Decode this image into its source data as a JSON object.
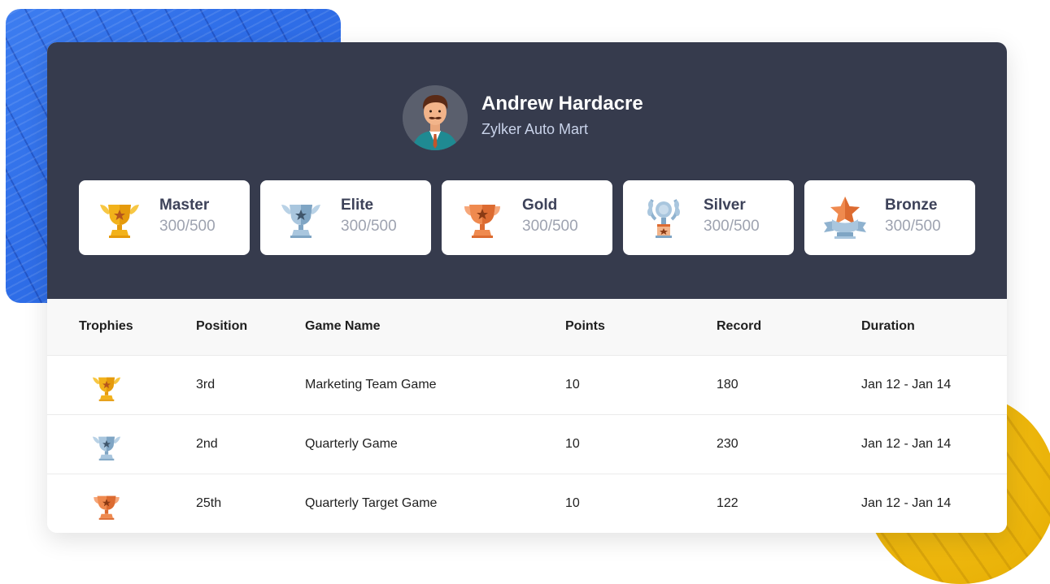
{
  "user": {
    "name": "Andrew Hardacre",
    "company": "Zylker Auto Mart"
  },
  "badges": [
    {
      "title": "Master",
      "value": "300/500",
      "icon": "gold-winged-trophy-icon"
    },
    {
      "title": "Elite",
      "value": "300/500",
      "icon": "silver-winged-trophy-icon"
    },
    {
      "title": "Gold",
      "value": "300/500",
      "icon": "bronze-cup-trophy-icon"
    },
    {
      "title": "Silver",
      "value": "300/500",
      "icon": "silver-laurel-trophy-icon"
    },
    {
      "title": "Bronze",
      "value": "300/500",
      "icon": "star-ribbon-trophy-icon"
    }
  ],
  "table": {
    "headers": [
      "Trophies",
      "Position",
      "Game Name",
      "Points",
      "Record",
      "Duration"
    ],
    "rows": [
      {
        "trophy": "gold-winged-trophy-icon",
        "position": "3rd",
        "game": "Marketing Team Game",
        "points": "10",
        "record": "180",
        "duration": "Jan 12 - Jan 14"
      },
      {
        "trophy": "silver-winged-trophy-icon",
        "position": "2nd",
        "game": "Quarterly Game",
        "points": "10",
        "record": "230",
        "duration": "Jan 12 - Jan 14"
      },
      {
        "trophy": "bronze-cup-trophy-icon",
        "position": "25th",
        "game": "Quarterly Target Game",
        "points": "10",
        "record": "122",
        "duration": "Jan 12 - Jan 14"
      }
    ]
  },
  "colors": {
    "header_bg": "#363b4d",
    "gold": "#f2b21b",
    "silver": "#8fb2cf",
    "bronze": "#ef8a4f",
    "deco_blue": "#2f6ee8",
    "deco_yellow": "#f1b90f"
  }
}
